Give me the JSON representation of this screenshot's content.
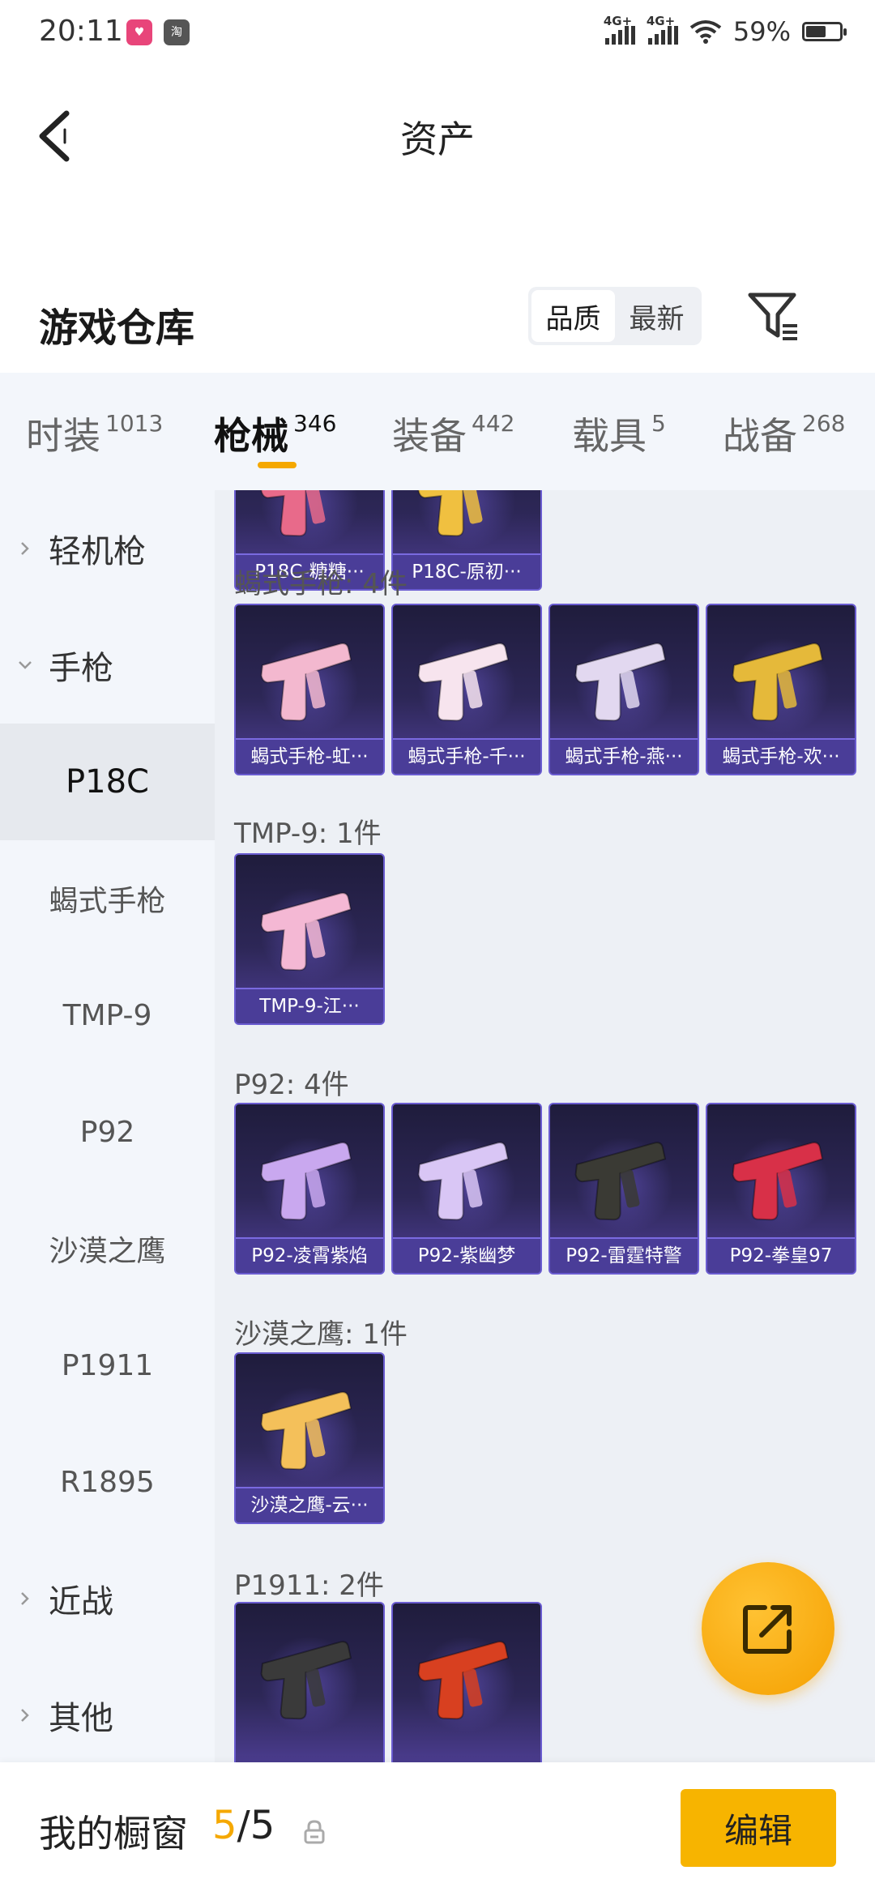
{
  "status_bar": {
    "time": "20:11",
    "battery": "59%",
    "battery_level": 0.59,
    "network_1": "4G+",
    "network_2": "4G+",
    "app_badges": [
      "app-icon-1",
      "淘"
    ]
  },
  "header": {
    "title": "资产",
    "back_icon": "chevron-left-icon"
  },
  "warehouse": {
    "title": "游戏仓库",
    "sort_options": [
      "品质",
      "最新"
    ],
    "active_sort": "品质",
    "filter_icon": "filter-icon"
  },
  "tabs": [
    {
      "label": "时装",
      "count": "1013"
    },
    {
      "label": "枪械",
      "count": "346",
      "active": true
    },
    {
      "label": "装备",
      "count": "442"
    },
    {
      "label": "载具",
      "count": "5"
    },
    {
      "label": "战备",
      "count": "268"
    }
  ],
  "sidenav": [
    {
      "label": "轻机枪",
      "type": "group",
      "expanded": false
    },
    {
      "label": "手枪",
      "type": "group",
      "expanded": true
    },
    {
      "label": "P18C",
      "type": "sub",
      "active": true
    },
    {
      "label": "蝎式手枪",
      "type": "sub"
    },
    {
      "label": "TMP-9",
      "type": "sub"
    },
    {
      "label": "P92",
      "type": "sub"
    },
    {
      "label": "沙漠之鹰",
      "type": "sub"
    },
    {
      "label": "P1911",
      "type": "sub"
    },
    {
      "label": "R1895",
      "type": "sub"
    },
    {
      "label": "近战",
      "type": "group",
      "expanded": false
    },
    {
      "label": "其他",
      "type": "group",
      "expanded": false
    }
  ],
  "sections": [
    {
      "label": "",
      "items": [
        "P18C-糖糖···",
        "P18C-原初···"
      ]
    },
    {
      "label": "蝎式手枪: 4件",
      "items": [
        "蝎式手枪-虹···",
        "蝎式手枪-千···",
        "蝎式手枪-燕···",
        "蝎式手枪-欢···"
      ]
    },
    {
      "label": "TMP-9: 1件",
      "items": [
        "TMP-9-江···"
      ]
    },
    {
      "label": "P92: 4件",
      "items": [
        "P92-凌霄紫焰",
        "P92-紫幽梦",
        "P92-雷霆特警",
        "P92-拳皇97"
      ]
    },
    {
      "label": "沙漠之鹰: 1件",
      "items": [
        "沙漠之鹰-云···"
      ]
    },
    {
      "label": "P1911: 2件",
      "items": [
        "",
        ""
      ]
    }
  ],
  "gun_colors": [
    [
      "#e86a8a",
      "#f0c040"
    ],
    [
      "#f3b8cf",
      "#f7e4ee",
      "#e2d8f0",
      "#e5b93a"
    ],
    [
      "#f4b8d4"
    ],
    [
      "#c9a8ef",
      "#d9c6f5",
      "#3a3a34",
      "#d83048"
    ],
    [
      "#f4c05a"
    ],
    [
      "#3a3a3a",
      "#d84020"
    ]
  ],
  "fab": {
    "icon": "share-icon"
  },
  "showcase": {
    "label": "我的橱窗",
    "current": "5",
    "separator": "/",
    "total": "5",
    "lock_icon": "lock-icon",
    "edit_label": "编辑"
  }
}
